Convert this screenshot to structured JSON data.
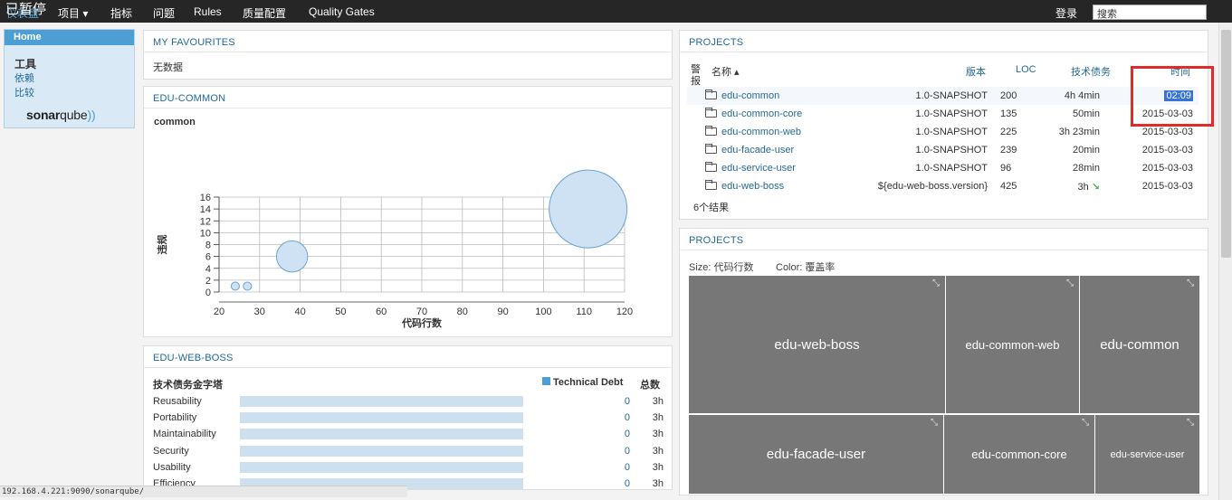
{
  "nav": {
    "paused_overlay": "已暂停",
    "dashboard": "仪表盘",
    "projects": "项目",
    "measures": "指标",
    "issues": "问题",
    "rules": "Rules",
    "quality_profiles": "质量配置",
    "quality_gates": "Quality Gates",
    "login": "登录",
    "search_placeholder": "搜索"
  },
  "sidebar": {
    "home": "Home",
    "tools_heading": "工具",
    "dependencies": "依赖",
    "compare": "比较",
    "logo_text": "sonar",
    "logo_text2": "qube"
  },
  "favourites": {
    "title": "MY FAVOURITES",
    "empty": "无数据"
  },
  "edu_common": {
    "title": "EDU-COMMON",
    "subtitle": "common"
  },
  "chart_data": {
    "type": "scatter",
    "title": "common",
    "xlabel": "代码行数",
    "ylabel": "违规",
    "xlim": [
      20,
      120
    ],
    "ylim": [
      0,
      16
    ],
    "xticks": [
      "20",
      "30",
      "40",
      "50",
      "60",
      "70",
      "80",
      "90",
      "100",
      "110",
      "120"
    ],
    "yticks": [
      "0",
      "2",
      "4",
      "6",
      "8",
      "10",
      "12",
      "14",
      "16"
    ],
    "grid": true,
    "points": [
      {
        "x": 24,
        "y": 1,
        "size": 1
      },
      {
        "x": 27,
        "y": 1,
        "size": 1
      },
      {
        "x": 38,
        "y": 6,
        "size": 4
      },
      {
        "x": 111,
        "y": 14,
        "size": 10
      }
    ]
  },
  "edu_web_boss": {
    "title": "EDU-WEB-BOSS",
    "heading": "技术债务金字塔",
    "legend": "Technical Debt",
    "total_label": "总数",
    "rows": [
      {
        "label": "Reusability",
        "debt": "0",
        "total": "3h",
        "fill": 1.0
      },
      {
        "label": "Portability",
        "debt": "0",
        "total": "3h",
        "fill": 1.0
      },
      {
        "label": "Maintainability",
        "debt": "0",
        "total": "3h",
        "fill": 1.0
      },
      {
        "label": "Security",
        "debt": "0",
        "total": "3h",
        "fill": 1.0
      },
      {
        "label": "Usability",
        "debt": "0",
        "total": "3h",
        "fill": 1.0
      },
      {
        "label": "Efficiency",
        "debt": "0",
        "total": "3h",
        "fill": 1.0
      }
    ]
  },
  "projects": {
    "title": "PROJECTS",
    "headers": {
      "alert": "警报",
      "name": "名称",
      "version": "版本",
      "loc": "LOC",
      "debt": "技术债务",
      "date": "时间"
    },
    "rows": [
      {
        "name": "edu-common",
        "version": "1.0-SNAPSHOT",
        "loc": "200",
        "debt": "4h 4min",
        "date": "02:09"
      },
      {
        "name": "edu-common-core",
        "version": "1.0-SNAPSHOT",
        "loc": "135",
        "debt": "50min",
        "date": "2015-03-03"
      },
      {
        "name": "edu-common-web",
        "version": "1.0-SNAPSHOT",
        "loc": "225",
        "debt": "3h 23min",
        "date": "2015-03-03"
      },
      {
        "name": "edu-facade-user",
        "version": "1.0-SNAPSHOT",
        "loc": "239",
        "debt": "20min",
        "date": "2015-03-03"
      },
      {
        "name": "edu-service-user",
        "version": "1.0-SNAPSHOT",
        "loc": "96",
        "debt": "28min",
        "date": "2015-03-03"
      },
      {
        "name": "edu-web-boss",
        "version": "${edu-web-boss.version}",
        "loc": "425",
        "debt": "3h",
        "date": "2015-03-03"
      }
    ],
    "footer": "6个结果"
  },
  "treemap": {
    "title": "PROJECTS",
    "size_label": "Size: 代码行数",
    "color_label": "Color: 覆盖率",
    "cells": [
      {
        "name": "edu-web-boss"
      },
      {
        "name": "edu-common-web"
      },
      {
        "name": "edu-common"
      },
      {
        "name": "edu-facade-user"
      },
      {
        "name": "edu-common-core"
      },
      {
        "name": "edu-service-user"
      }
    ],
    "cell_color": "#777777"
  },
  "statusbar": {
    "url": "192.168.4.221:9090/sonarqube/"
  },
  "accent": {
    "highlight_box": "#e02b2b",
    "link": "#236a97",
    "nav_bg": "#262626"
  }
}
